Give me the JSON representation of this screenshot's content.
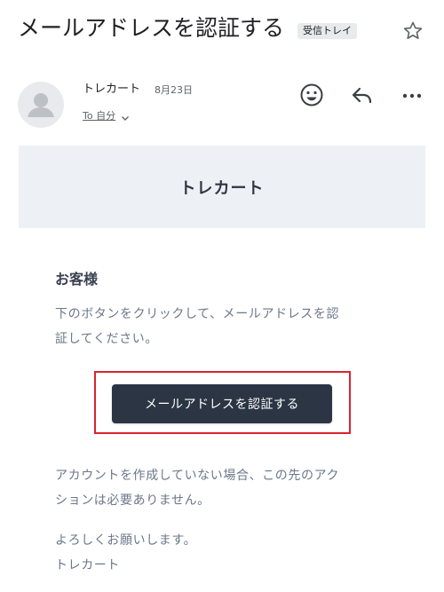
{
  "email": {
    "subject": "メールアドレスを認証する",
    "label": "受信トレイ",
    "sender": "トレカート",
    "date": "8月23日",
    "recipient": "To 自分",
    "icons": {
      "star": "star-icon",
      "emoji": "emoji-icon",
      "reply": "reply-icon",
      "more": "more-icon",
      "expand": "chevron-down-icon",
      "avatar": "avatar-person-icon"
    }
  },
  "body": {
    "brand": "トレカート",
    "greeting": "お客様",
    "instruction_line1": "下のボタンをクリックして、メールアドレスを認",
    "instruction_line2": "証してください。",
    "verify_button": "メールアドレスを認証する",
    "note_line1": "アカウントを作成していない場合、この先のアク",
    "note_line2": "ションは必要ありません。",
    "closing_line1": "よろしくお願いします。",
    "closing_line2": "トレカート",
    "colors": {
      "banner_bg": "#edf1f6",
      "button_bg": "#2b3544",
      "highlight": "#d9232d",
      "body_text": "#6b7789"
    }
  }
}
